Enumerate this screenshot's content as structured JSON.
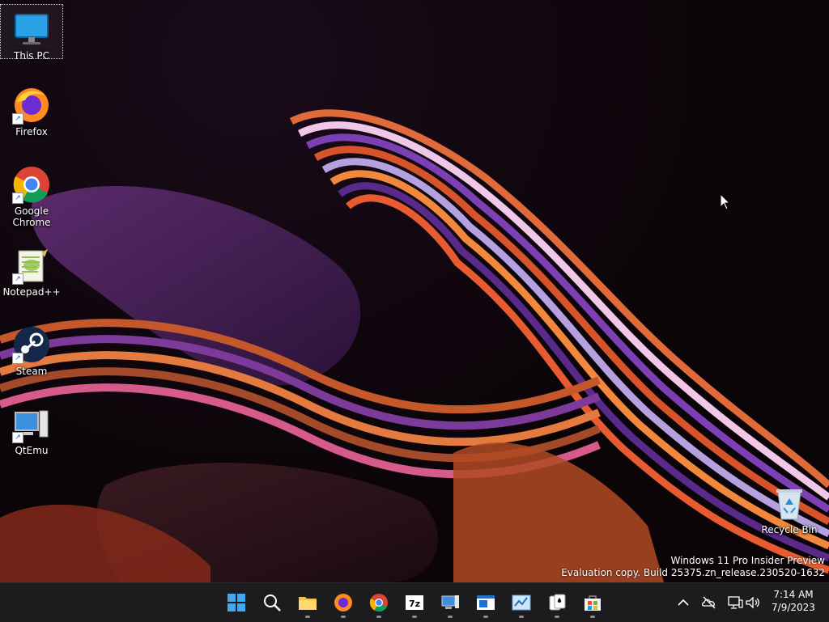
{
  "desktop": {
    "icons": [
      {
        "label": "This PC",
        "icon": "monitor-icon"
      },
      {
        "label": "Firefox",
        "icon": "firefox-icon"
      },
      {
        "label": "Google Chrome",
        "icon": "chrome-icon"
      },
      {
        "label": "Notepad++",
        "icon": "notepadpp-icon"
      },
      {
        "label": "Steam",
        "icon": "steam-icon"
      },
      {
        "label": "QtEmu",
        "icon": "qtemu-icon"
      }
    ],
    "recycle_bin": {
      "label": "Recycle Bin",
      "icon": "recycle-bin-icon"
    },
    "watermark": {
      "line1": "Windows 11 Pro Insider Preview",
      "line2": "Evaluation copy. Build 25375.zn_release.230520-1632"
    }
  },
  "taskbar": {
    "items": [
      {
        "name": "start",
        "icon": "windows-start-icon"
      },
      {
        "name": "search",
        "icon": "search-icon"
      },
      {
        "name": "file-explorer",
        "icon": "folder-icon"
      },
      {
        "name": "firefox",
        "icon": "firefox-icon"
      },
      {
        "name": "chrome",
        "icon": "chrome-icon"
      },
      {
        "name": "7zip",
        "icon": "seven-zip-icon"
      },
      {
        "name": "remote-desktop",
        "icon": "computer-icon"
      },
      {
        "name": "window-app",
        "icon": "window-icon"
      },
      {
        "name": "control-panel",
        "icon": "control-panel-icon"
      },
      {
        "name": "solitaire",
        "icon": "cards-icon"
      },
      {
        "name": "store",
        "icon": "store-icon"
      }
    ],
    "tray": {
      "chevron": "chevron-up-icon",
      "icons": [
        "onedrive-icon",
        "network-icon",
        "volume-icon"
      ],
      "time": "7:14 AM",
      "date": "7/9/2023"
    }
  },
  "colors": {
    "taskbar_bg": "#1c1c1f",
    "accent": "#0078d4"
  }
}
